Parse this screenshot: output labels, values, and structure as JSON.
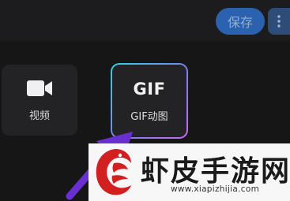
{
  "toolbar": {
    "save_label": "保存",
    "more_icon": "more-vertical-icon",
    "save_color": "#2d6fc9"
  },
  "tools": [
    {
      "label": "视频",
      "icon": "video-camera-icon"
    },
    {
      "label": "GIF动图",
      "icon_text": "GIF",
      "selected": true
    }
  ],
  "overlay": {
    "arrow_color": "#6a2fd0"
  },
  "watermark": {
    "title": "虾皮手游网",
    "url": "www.xiapizhijia.com",
    "logo_color": "#d21f1f"
  }
}
